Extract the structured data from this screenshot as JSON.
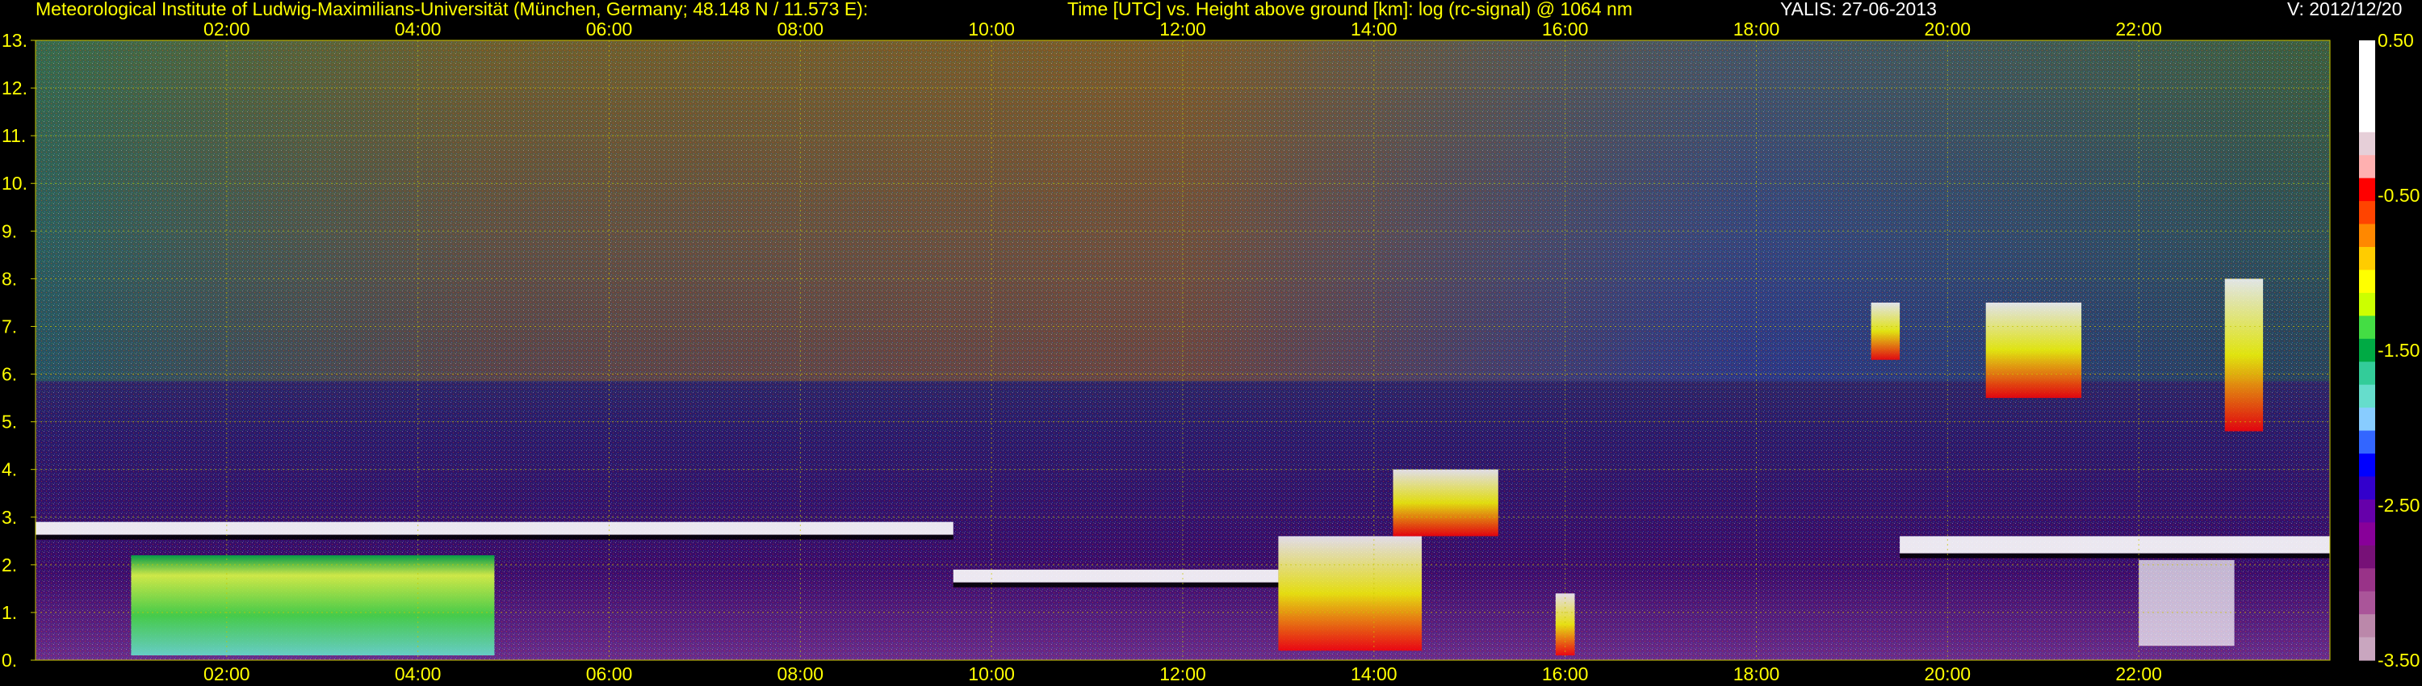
{
  "header": {
    "institute": "Meteorological Institute of Ludwig-Maximilians-Universität (München, Germany; 48.148 N / 11.573 E):",
    "axes_description": "Time [UTC] vs. Height above ground [km]: log (rc-signal) @ 1064 nm",
    "instrument_date": "YALIS: 27-06-2013",
    "version": "V: 2012/12/20"
  },
  "colors": {
    "text": "#ffff00",
    "grid": "#c8c800",
    "background": "#000000"
  },
  "chart_data": {
    "type": "heatmap",
    "xlabel": "",
    "ylabel": "",
    "x_tick_labels": [
      "02:00",
      "04:00",
      "06:00",
      "08:00",
      "10:00",
      "12:00",
      "14:00",
      "16:00",
      "18:00",
      "20:00",
      "22:00"
    ],
    "x_tick_hours": [
      2,
      4,
      6,
      8,
      10,
      12,
      14,
      16,
      18,
      20,
      22
    ],
    "xlim_hours": [
      0,
      24
    ],
    "y_tick_labels": [
      "0.",
      "1.",
      "2.",
      "3.",
      "4.",
      "5.",
      "6.",
      "7.",
      "8.",
      "9.",
      "10.",
      "11.",
      "12.",
      "13."
    ],
    "ylim_km": [
      0,
      13
    ],
    "grid": true,
    "colorbar": {
      "range": [
        -3.5,
        0.5
      ],
      "tick_labels": [
        "0.50",
        "-0.50",
        "-1.50",
        "-2.50",
        "-3.50"
      ],
      "tick_values": [
        0.5,
        -0.5,
        -1.5,
        -2.5,
        -3.5
      ],
      "colors": [
        "#ffffff",
        "#ffffff",
        "#ffffff",
        "#ffffff",
        "#e6cfd8",
        "#ffb0b0",
        "#ff0000",
        "#ff4400",
        "#ff8800",
        "#ffcc00",
        "#ffff00",
        "#ccff00",
        "#44dd44",
        "#00aa44",
        "#33cc99",
        "#66ddcc",
        "#88ccff",
        "#3366ff",
        "#0000ff",
        "#3300cc",
        "#6600aa",
        "#880099",
        "#771177",
        "#993388",
        "#aa5599",
        "#bb88aa",
        "#c9a6bf"
      ]
    },
    "layers": [
      {
        "name": "boundary-layer-top",
        "t0": 0.0,
        "t1": 9.6,
        "h0": 2.3,
        "h1": 2.9
      },
      {
        "name": "boundary-layer-aerosol",
        "t0": 1.0,
        "t1": 4.8,
        "h0": 0.1,
        "h1": 2.2
      },
      {
        "name": "residual-layer",
        "t0": 9.6,
        "t1": 13.0,
        "h0": 1.3,
        "h1": 1.9
      },
      {
        "name": "convective-cloud-1",
        "t0": 13.0,
        "t1": 14.5,
        "h0": 0.2,
        "h1": 2.6
      },
      {
        "name": "convective-cloud-2",
        "t0": 14.2,
        "t1": 15.3,
        "h0": 2.6,
        "h1": 4.0
      },
      {
        "name": "convective-cloud-3",
        "t0": 15.9,
        "t1": 16.1,
        "h0": 0.1,
        "h1": 1.4
      },
      {
        "name": "mid-level-cloud-1",
        "t0": 19.2,
        "t1": 19.5,
        "h0": 6.3,
        "h1": 7.5
      },
      {
        "name": "mid-level-cloud-2",
        "t0": 20.4,
        "t1": 21.4,
        "h0": 5.5,
        "h1": 7.5
      },
      {
        "name": "mid-level-cloud-3",
        "t0": 22.9,
        "t1": 23.3,
        "h0": 4.8,
        "h1": 8.0
      },
      {
        "name": "evening-boundary-layer",
        "t0": 19.5,
        "t1": 24.0,
        "h0": 1.8,
        "h1": 2.6
      },
      {
        "name": "evening-low-cloud",
        "t0": 22.0,
        "t1": 23.0,
        "h0": 0.3,
        "h1": 2.1
      }
    ]
  }
}
